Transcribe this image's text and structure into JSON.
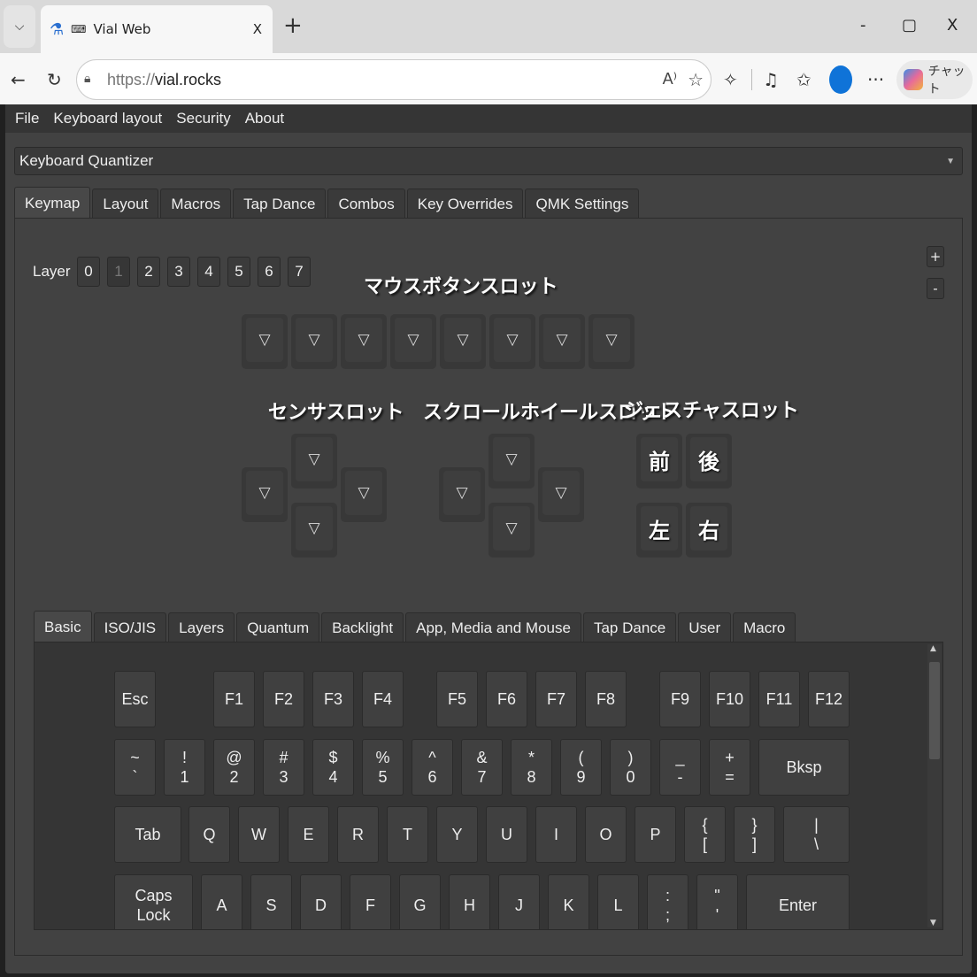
{
  "browser": {
    "tab_title": "Vial Web",
    "tab_close": "X",
    "new_tab": "+",
    "url_proto": "https://",
    "url_host": "vial.rocks",
    "minimize": "-",
    "maximize": "▢",
    "close": "X",
    "back": "←",
    "reload": "↻",
    "chat_label": "チャット",
    "more": "···"
  },
  "menu": [
    "File",
    "Keyboard layout",
    "Security",
    "About"
  ],
  "keyboard_select": {
    "value": "Keyboard Quantizer"
  },
  "main_tabs": [
    "Keymap",
    "Layout",
    "Macros",
    "Tap Dance",
    "Combos",
    "Key Overrides",
    "QMK Settings"
  ],
  "layer": {
    "label": "Layer",
    "buttons": [
      "0",
      "1",
      "2",
      "3",
      "4",
      "5",
      "6",
      "7"
    ],
    "selected": 1,
    "plus": "+",
    "minus": "-"
  },
  "slots": {
    "mouse_title": "マウスボタンスロット",
    "sensor_title": "センサスロット",
    "scroll_title": "スクロールホイールスロット",
    "gesture_title": "ジェスチャスロット",
    "empty": "▽",
    "gesture_keys": [
      "前",
      "後",
      "左",
      "右"
    ]
  },
  "keycode_tabs": [
    "Basic",
    "ISO/JIS",
    "Layers",
    "Quantum",
    "Backlight",
    "App, Media and Mouse",
    "Tap Dance",
    "User",
    "Macro"
  ],
  "keycodes": {
    "row1": [
      "Esc",
      "F1",
      "F2",
      "F3",
      "F4",
      "F5",
      "F6",
      "F7",
      "F8",
      "F9",
      "F10",
      "F11",
      "F12"
    ],
    "row2": [
      "~\n`",
      "!\n1",
      "@\n2",
      "#\n3",
      "$\n4",
      "%\n5",
      "^\n6",
      "&\n7",
      "*\n8",
      "(\n9",
      ")\n0",
      "_\n-",
      "+\n=",
      "Bksp"
    ],
    "row3": [
      "Tab",
      "Q",
      "W",
      "E",
      "R",
      "T",
      "Y",
      "U",
      "I",
      "O",
      "P",
      "{\n[",
      "}\n]",
      "|\n\\"
    ],
    "row4": [
      "Caps\nLock",
      "A",
      "S",
      "D",
      "F",
      "G",
      "H",
      "J",
      "K",
      "L",
      ":\n;",
      "\"\n'",
      "Enter"
    ]
  }
}
